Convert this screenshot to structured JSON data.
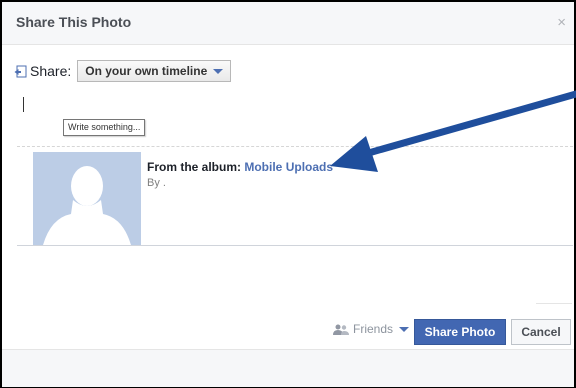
{
  "dialog": {
    "title": "Share This Photo",
    "close_glyph": "×"
  },
  "share": {
    "label": "Share:",
    "target_value": "On your own timeline",
    "icon": "share-icon"
  },
  "composer": {
    "tooltip": "Write something..."
  },
  "attachment": {
    "album_prefix": "From the album:",
    "album_name": "Mobile Uploads",
    "byline": "By ."
  },
  "footer": {
    "audience_label": "Friends",
    "audience_icon": "friends-icon",
    "share_button": "Share Photo",
    "cancel_button": "Cancel"
  },
  "colors": {
    "brand_blue": "#4267b2",
    "arrow_blue": "#1f4e9c",
    "thumb_bg": "#bccde6"
  }
}
